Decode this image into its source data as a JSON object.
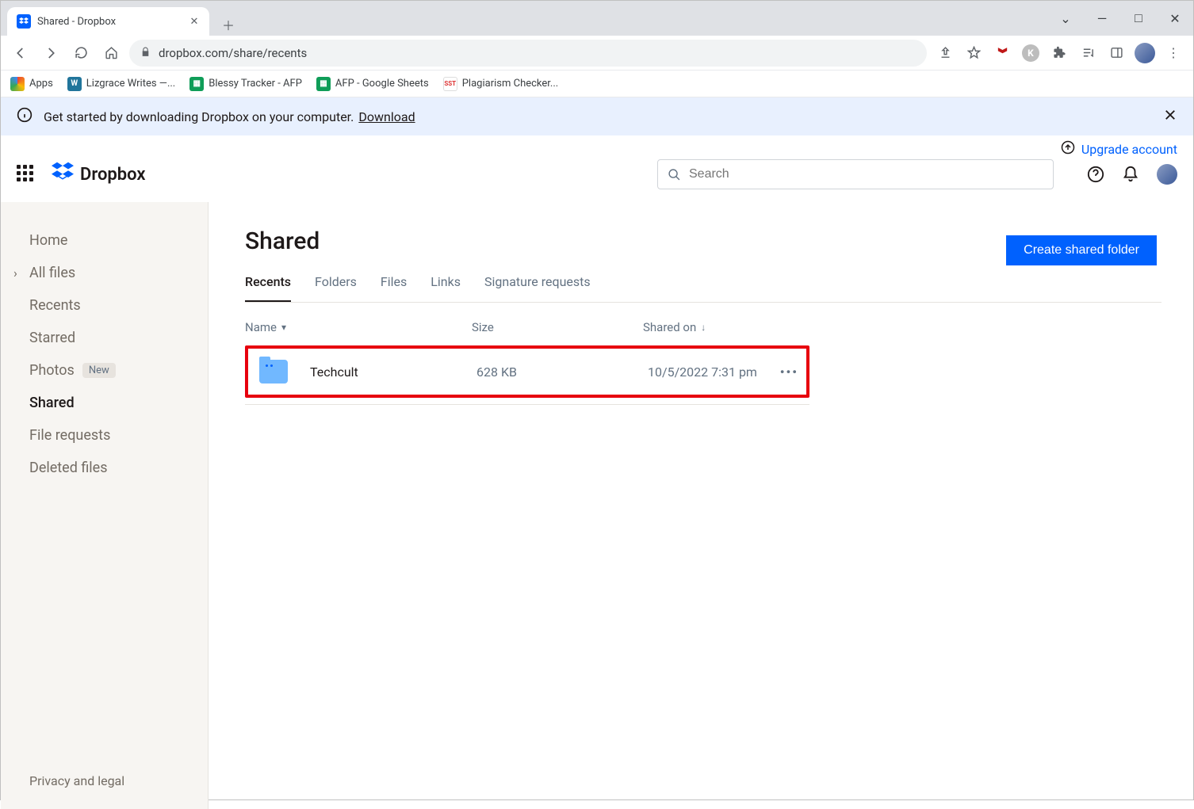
{
  "browser": {
    "tab_title": "Shared - Dropbox",
    "url": "dropbox.com/share/recents",
    "bookmarks": [
      {
        "label": "Apps",
        "icon": "grid-color"
      },
      {
        "label": "Lizgrace Writes —...",
        "icon": "wp"
      },
      {
        "label": "Blessy Tracker - AFP",
        "icon": "sheets"
      },
      {
        "label": "AFP - Google Sheets",
        "icon": "sheets"
      },
      {
        "label": "Plagiarism Checker...",
        "icon": "sst"
      }
    ]
  },
  "banner": {
    "text": "Get started by downloading Dropbox on your computer.",
    "link": "Download"
  },
  "upgrade_label": "Upgrade account",
  "app": {
    "brand": "Dropbox",
    "search_placeholder": "Search"
  },
  "sidebar": {
    "items": [
      {
        "label": "Home"
      },
      {
        "label": "All files",
        "chevron": true
      },
      {
        "label": "Recents"
      },
      {
        "label": "Starred"
      },
      {
        "label": "Photos",
        "badge": "New"
      },
      {
        "label": "Shared",
        "active": true
      },
      {
        "label": "File requests"
      },
      {
        "label": "Deleted files"
      }
    ],
    "footer": "Privacy and legal"
  },
  "page": {
    "title": "Shared",
    "cta": "Create shared folder",
    "tabs": [
      "Recents",
      "Folders",
      "Files",
      "Links",
      "Signature requests"
    ],
    "active_tab": 0,
    "columns": {
      "name": "Name",
      "size": "Size",
      "shared": "Shared on"
    },
    "rows": [
      {
        "name": "Techcult",
        "size": "628 KB",
        "shared": "10/5/2022 7:31 pm"
      }
    ]
  }
}
